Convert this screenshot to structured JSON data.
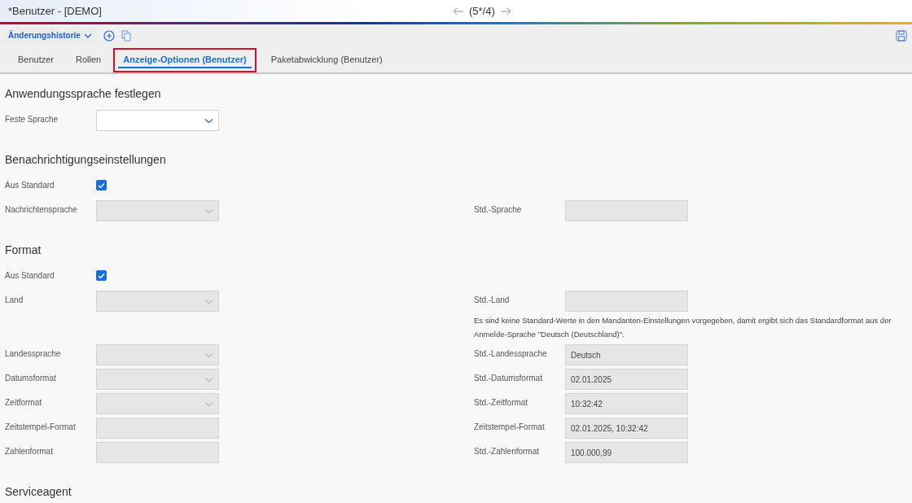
{
  "window": {
    "title": "*Benutzer - [DEMO]",
    "counter": "(5*/4)"
  },
  "toolbar": {
    "history_button": "Änderungshistorie"
  },
  "tabs": [
    {
      "label": "Benutzer",
      "selected": false,
      "highlighted": false
    },
    {
      "label": "Rollen",
      "selected": false,
      "highlighted": false
    },
    {
      "label": "Anzeige-Optionen (Benutzer)",
      "selected": true,
      "highlighted": true
    },
    {
      "label": "Paketabwicklung (Benutzer)",
      "selected": false,
      "highlighted": false
    }
  ],
  "sections": [
    {
      "title": "Anwendungssprache festlegen",
      "rows": [
        {
          "left": {
            "label": "Feste Sprache",
            "kind": "select",
            "disabled": false
          }
        }
      ]
    },
    {
      "title": "Benachrichtigungseinstellungen",
      "rows": [
        {
          "left": {
            "label": "Aus Standard",
            "kind": "checkbox",
            "checked": true
          }
        },
        {
          "left": {
            "label": "Nachrichtensprache",
            "kind": "select",
            "disabled": true
          },
          "right": {
            "label": "Std.-Sprache",
            "kind": "text",
            "disabled": true
          }
        }
      ]
    },
    {
      "title": "Format",
      "rows": [
        {
          "left": {
            "label": "Aus Standard",
            "kind": "checkbox",
            "checked": true
          }
        },
        {
          "left": {
            "label": "Land",
            "kind": "select",
            "disabled": true
          },
          "right": {
            "label": "Std.-Land",
            "kind": "text",
            "disabled": true
          }
        },
        {
          "right": {
            "kind": "note",
            "text": "Es sind keine Standard-Werte in den Mandanten-Einstellungen vorgegeben, damit ergibt sich das Standardformat aus der Anmelde-Sprache \"Deutsch (Deutschland)\"."
          }
        },
        {
          "left": {
            "label": "Landessprache",
            "kind": "select",
            "disabled": true
          },
          "right": {
            "label": "Std.-Landessprache",
            "kind": "text",
            "disabled": true,
            "value": "Deutsch"
          }
        },
        {
          "left": {
            "label": "Datumsformat",
            "kind": "select",
            "disabled": true
          },
          "right": {
            "label": "Std.-Datumsformat",
            "kind": "text",
            "disabled": true,
            "value": "02.01.2025"
          }
        },
        {
          "left": {
            "label": "Zeitformat",
            "kind": "select",
            "disabled": true
          },
          "right": {
            "label": "Std.-Zeitformat",
            "kind": "text",
            "disabled": true,
            "value": "10:32:42"
          }
        },
        {
          "left": {
            "label": "Zeitstempel-Format",
            "kind": "text",
            "disabled": true
          },
          "right": {
            "label": "Zeitstempel-Format",
            "kind": "text",
            "disabled": true,
            "value": "02.01.2025, 10:32:42"
          }
        },
        {
          "left": {
            "label": "Zahlenformat",
            "kind": "text",
            "disabled": true
          },
          "right": {
            "label": "Std.-Zahlenformat",
            "kind": "text",
            "disabled": true,
            "value": "100.000,99"
          }
        }
      ]
    },
    {
      "title": "Serviceagent"
    }
  ]
}
